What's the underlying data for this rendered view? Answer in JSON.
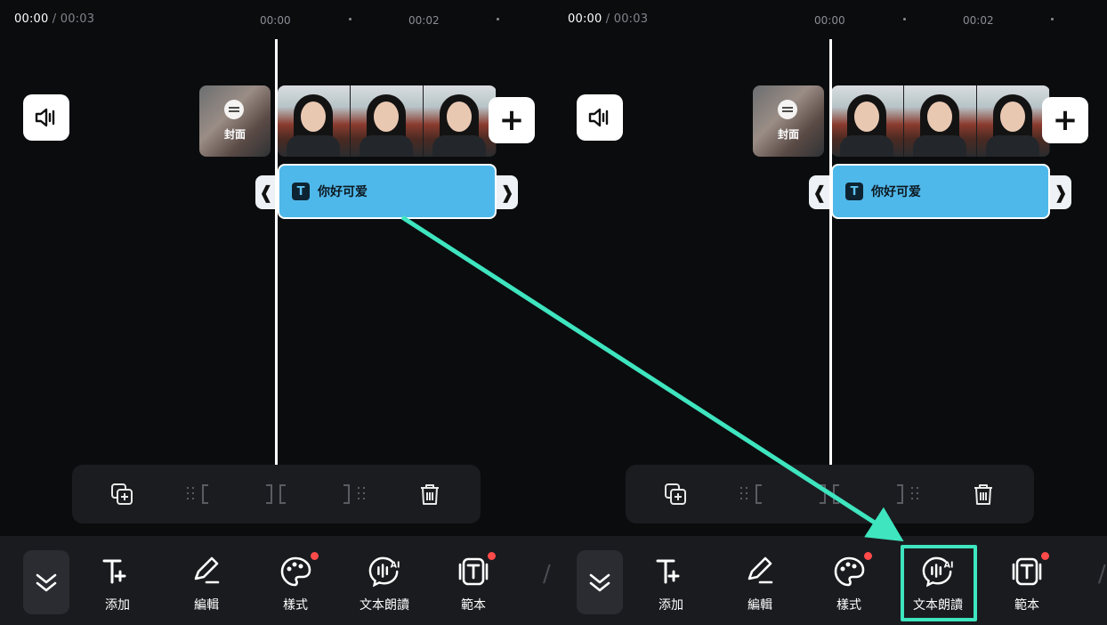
{
  "time": {
    "current": "00:00",
    "separator": " / ",
    "total": "00:03"
  },
  "ruler": {
    "mark1": "00:00",
    "mark2": "00:02"
  },
  "cover": {
    "label": "封面"
  },
  "text_clip": {
    "badge": "T",
    "text": "你好可爱"
  },
  "handles": {
    "left": "❰",
    "right": "❱"
  },
  "add_symbol": "+",
  "edit_tools": [
    {
      "icon": "duplicate-icon"
    },
    {
      "icon": "trim-start-icon"
    },
    {
      "icon": "split-icon"
    },
    {
      "icon": "trim-end-icon"
    },
    {
      "icon": "trash-icon"
    }
  ],
  "toolbar": [
    {
      "label": "添加",
      "icon": "add-text-icon",
      "badge": false
    },
    {
      "label": "編輯",
      "icon": "pencil-icon",
      "badge": false
    },
    {
      "label": "樣式",
      "icon": "palette-icon",
      "badge": true
    },
    {
      "label": "文本朗讀",
      "icon": "ai-voice-icon",
      "badge": false
    },
    {
      "label": "範本",
      "icon": "template-icon",
      "badge": true
    }
  ],
  "colors": {
    "background": "#0b0c0e",
    "text_clip": "#4fb8ea",
    "highlight": "#3ee5bf",
    "badge_red": "#ff4a4a"
  }
}
